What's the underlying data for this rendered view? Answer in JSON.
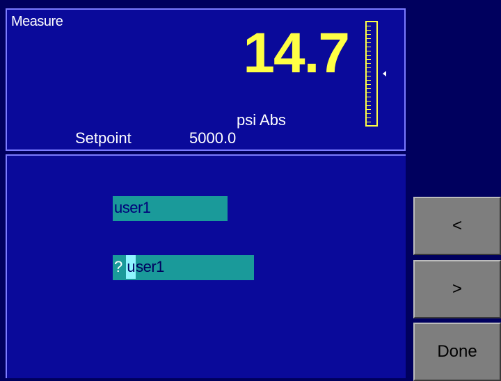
{
  "measure": {
    "title": "Measure",
    "reading": "14.7",
    "units": "psi Abs",
    "setpoint_label": "Setpoint",
    "setpoint_value": "5000.0",
    "gauge_level": 0.5
  },
  "edit": {
    "current_value": "user1",
    "prompt_symbol": "?",
    "cursor_char": "u",
    "new_value_rest": "ser1"
  },
  "softkeys": {
    "prev_label": "<",
    "next_label": ">",
    "done_label": "Done"
  },
  "colors": {
    "background": "#00005e",
    "panel": "#0a0a9a",
    "reading": "#ffff44",
    "field": "#1a9a9a",
    "softkey": "#7e7e7e"
  }
}
